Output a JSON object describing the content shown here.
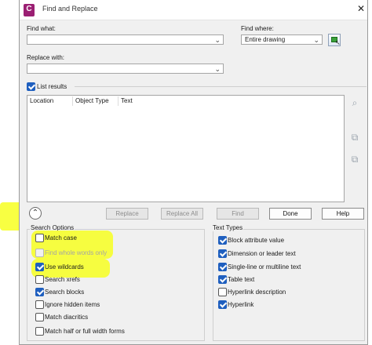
{
  "window": {
    "title": "Find and Replace",
    "close_glyph": "✕",
    "app_icon": "autocad-app-icon"
  },
  "find": {
    "label": "Find what:",
    "value": ""
  },
  "find_where": {
    "label": "Find where:",
    "value": "Entire drawing"
  },
  "replace": {
    "label": "Replace with:",
    "value": ""
  },
  "list_results": {
    "label": "List results",
    "checked": true
  },
  "results_table": {
    "columns": [
      "Location",
      "Object Type",
      "Text"
    ],
    "rows": []
  },
  "buttons": {
    "replace": "Replace",
    "replace_all": "Replace All",
    "find": "Find",
    "done": "Done",
    "help": "Help"
  },
  "search_options": {
    "title": "Search Options",
    "items": [
      {
        "label": "Match case",
        "checked": false,
        "enabled": true
      },
      {
        "label": "Find whole words only",
        "checked": false,
        "enabled": false
      },
      {
        "label": "Use wildcards",
        "checked": true,
        "enabled": true
      },
      {
        "label": "Search xrefs",
        "checked": false,
        "enabled": true
      },
      {
        "label": "Search blocks",
        "checked": true,
        "enabled": true
      },
      {
        "label": "Ignore hidden items",
        "checked": false,
        "enabled": true
      },
      {
        "label": "Match diacritics",
        "checked": false,
        "enabled": true
      },
      {
        "label": "Match half or full width forms",
        "checked": false,
        "enabled": true
      }
    ]
  },
  "text_types": {
    "title": "Text Types",
    "items": [
      {
        "label": "Block attribute value",
        "checked": true
      },
      {
        "label": "Dimension or leader text",
        "checked": true
      },
      {
        "label": "Single-line or multiline text",
        "checked": true
      },
      {
        "label": "Table text",
        "checked": true
      },
      {
        "label": "Hyperlink description",
        "checked": false
      },
      {
        "label": "Hyperlink",
        "checked": true
      }
    ]
  },
  "colors": {
    "highlight": "#f7ff21",
    "check_accent": "#1f5fbf",
    "app_icon": "#9b1f73"
  }
}
